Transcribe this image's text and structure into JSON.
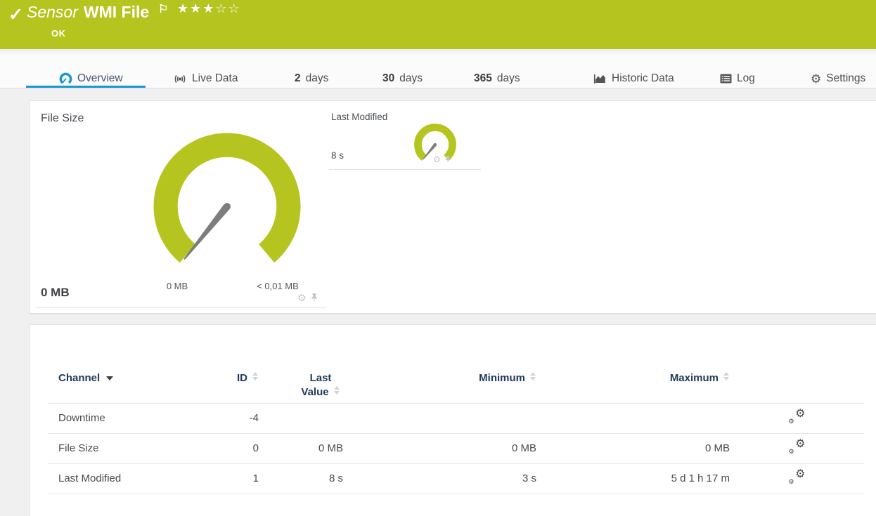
{
  "header": {
    "status_label": "OK",
    "kind": "Sensor",
    "title": "WMI File",
    "stars": "★★★☆☆"
  },
  "tabs": {
    "overview": "Overview",
    "live_data": "Live Data",
    "d2_num": "2",
    "d2_unit": "days",
    "d30_num": "30",
    "d30_unit": "days",
    "d365_num": "365",
    "d365_unit": "days",
    "historic": "Historic Data",
    "log": "Log",
    "settings": "Settings"
  },
  "gauges": {
    "file_size": {
      "title": "File Size",
      "value": "0 MB",
      "min": "0 MB",
      "max": "< 0,01 MB"
    },
    "last_modified": {
      "title": "Last Modified",
      "value": "8 s"
    }
  },
  "channel_table": {
    "headers": {
      "channel": "Channel",
      "id": "ID",
      "last_value": "Last Value",
      "minimum": "Minimum",
      "maximum": "Maximum"
    },
    "rows": [
      {
        "channel": "Downtime",
        "id": "-4",
        "last_value": "",
        "minimum": "",
        "maximum": ""
      },
      {
        "channel": "File Size",
        "id": "0",
        "last_value": "0 MB",
        "minimum": "0 MB",
        "maximum": "0 MB"
      },
      {
        "channel": "Last Modified",
        "id": "1",
        "last_value": "8 s",
        "minimum": "3 s",
        "maximum": "5 d 1 h 17 m"
      }
    ]
  },
  "colors": {
    "brand_green": "#b5c41e",
    "accent_blue": "#1a96d5",
    "status_ok": "#b5c41e"
  }
}
